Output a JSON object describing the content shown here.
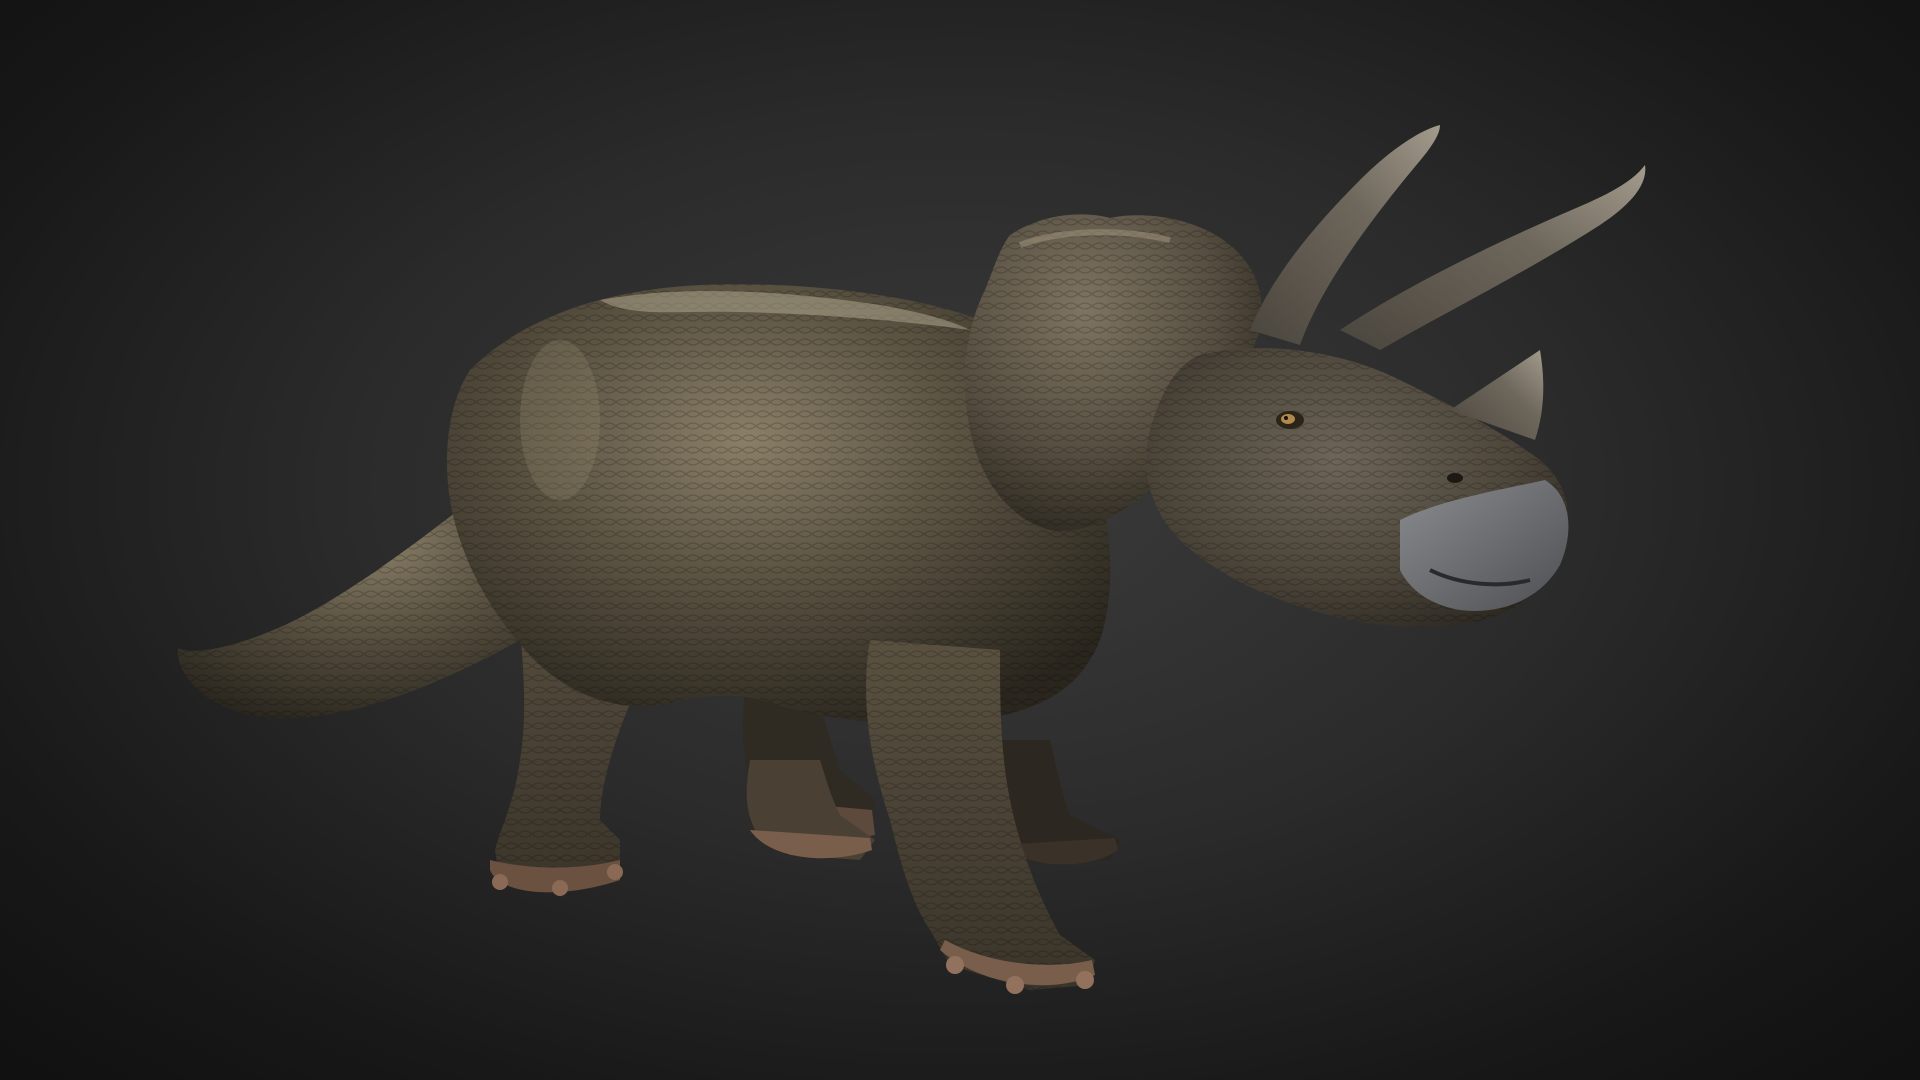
{
  "viewer": {
    "subject": "triceratops",
    "background_color": "#2e2e2e"
  },
  "model": {
    "skin_color": "#5c5443",
    "skin_highlight": "#8a7f68",
    "skin_shadow": "#2a261e",
    "horn_color": "#6e675c",
    "beak_color": "#77797d",
    "claw_color": "#7a5e4c"
  }
}
